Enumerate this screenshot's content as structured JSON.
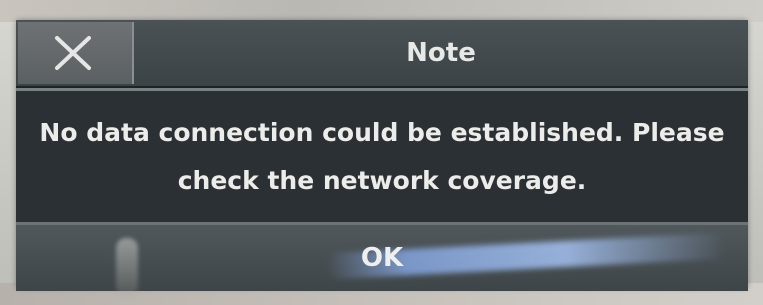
{
  "dialog": {
    "title": "Note",
    "close_icon": "close-icon",
    "message": "No data connection could be established. Please check the network coverage.",
    "ok_label": "OK"
  }
}
